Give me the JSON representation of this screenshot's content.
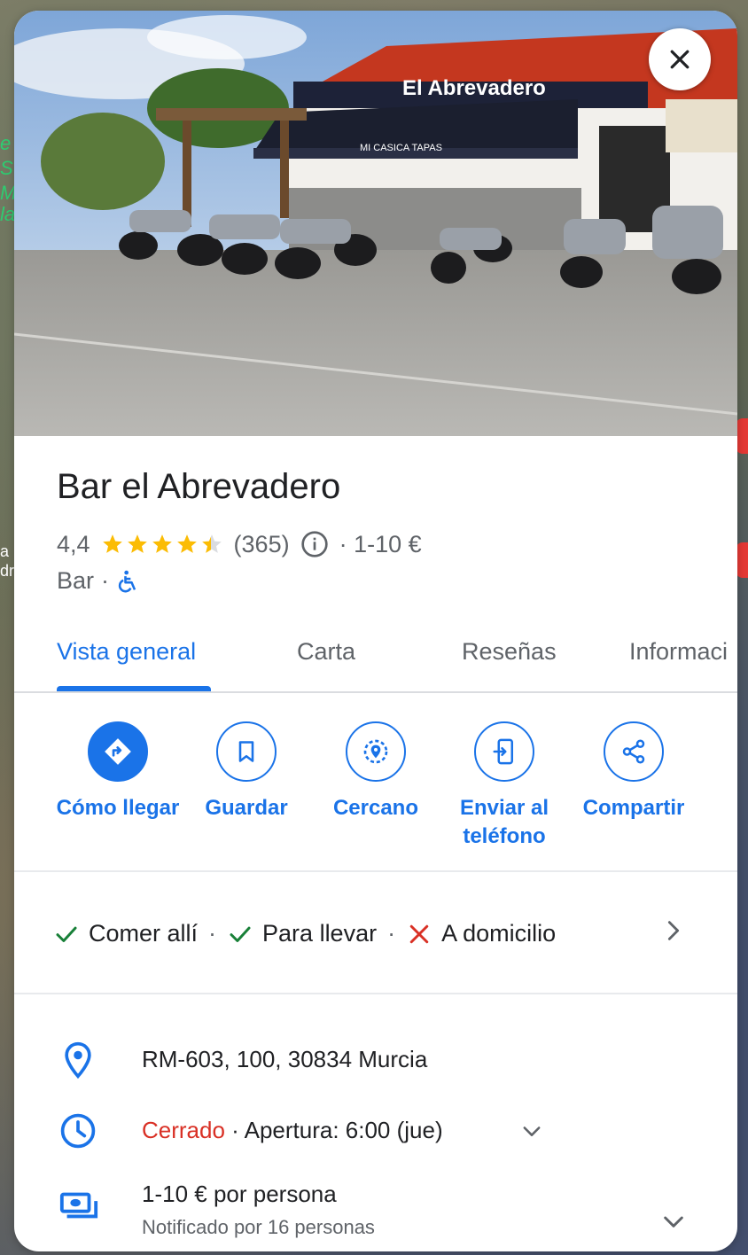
{
  "map": {
    "fragments": [
      "e",
      "S",
      "M",
      "la"
    ],
    "fragments_mid": [
      "a",
      "dr"
    ]
  },
  "place": {
    "name": "Bar el Abrevadero",
    "rating": "4,4",
    "rating_value": 4.4,
    "reviews": "(365)",
    "price": "· 1-10 €",
    "category": "Bar",
    "category_sep": "·",
    "accessibility_icon": "wheelchair-icon"
  },
  "photo": {
    "sign_text": "El Abrevadero",
    "awning_text": "MI CASICA TAPAS"
  },
  "tabs": [
    {
      "label": "Vista general",
      "active": true
    },
    {
      "label": "Carta",
      "active": false
    },
    {
      "label": "Reseñas",
      "active": false
    },
    {
      "label": "Informaci",
      "active": false
    }
  ],
  "actions": [
    {
      "label": "Cómo llegar",
      "icon": "directions-icon"
    },
    {
      "label": "Guardar",
      "icon": "bookmark-icon"
    },
    {
      "label": "Cercano",
      "icon": "nearby-icon"
    },
    {
      "label": "Enviar al teléfono",
      "icon": "send-to-phone-icon"
    },
    {
      "label": "Compartir",
      "icon": "share-icon"
    }
  ],
  "services": [
    {
      "label": "Comer allí",
      "available": true
    },
    {
      "label": "Para llevar",
      "available": true
    },
    {
      "label": "A domicilio",
      "available": false
    }
  ],
  "services_sep": "·",
  "address": "RM-603, 100, 30834 Murcia",
  "hours": {
    "status": "Cerrado",
    "detail": "· Apertura: 6:00 (jue)"
  },
  "price_info": {
    "main": "1-10 € por persona",
    "sub": "Notificado por 16 personas"
  },
  "colors": {
    "accent": "#1a73e8",
    "closed": "#d93025",
    "check": "#188038",
    "cross": "#d93025",
    "star": "#fbbc04"
  }
}
